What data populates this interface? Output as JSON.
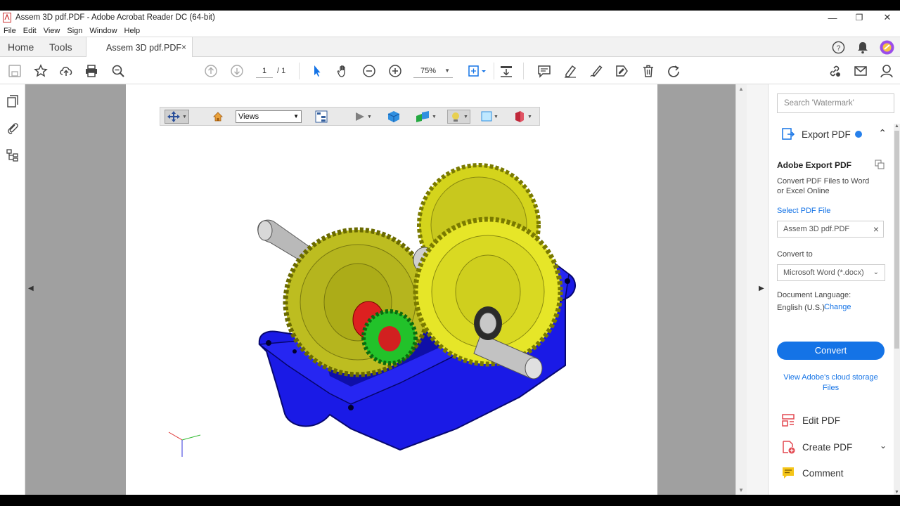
{
  "window": {
    "title": "Assem 3D pdf.PDF - Adobe Acrobat Reader DC (64-bit)",
    "minimize": "—",
    "maximize": "❐",
    "close": "✕"
  },
  "menu": [
    "File",
    "Edit",
    "View",
    "Sign",
    "Window",
    "Help"
  ],
  "tabs": {
    "home": "Home",
    "tools": "Tools",
    "document": "Assem 3D pdf.PDF",
    "close": "×"
  },
  "toolbar": {
    "page_current": "1",
    "page_total": "/ 1",
    "zoom": "75%"
  },
  "toolbar3d": {
    "views_select": "Views"
  },
  "right_panel": {
    "search_placeholder": "Search 'Watermark'",
    "export_header": "Export PDF",
    "adobe_export_title": "Adobe Export PDF",
    "description": "Convert PDF Files to Word or Excel Online",
    "select_file_label": "Select PDF File",
    "selected_file": "Assem 3D pdf.PDF",
    "convert_to_label": "Convert to",
    "convert_to_value": "Microsoft Word (*.docx)",
    "doc_language_label": "Document Language:",
    "doc_language_value": "English (U.S.)",
    "change_link": "Change",
    "convert_button": "Convert",
    "cloud_link_line1": "View Adobe's cloud storage",
    "cloud_link_line2": "Files",
    "tools": [
      {
        "label": "Edit PDF",
        "icon": "edit-pdf-icon"
      },
      {
        "label": "Create PDF",
        "icon": "create-pdf-icon"
      },
      {
        "label": "Comment",
        "icon": "comment-icon"
      }
    ]
  },
  "colors": {
    "accent": "#1473e6",
    "housing_blue": "#1a1ae6",
    "gear_yellow": "#dcdc2a",
    "gear_green": "#22c22a"
  }
}
